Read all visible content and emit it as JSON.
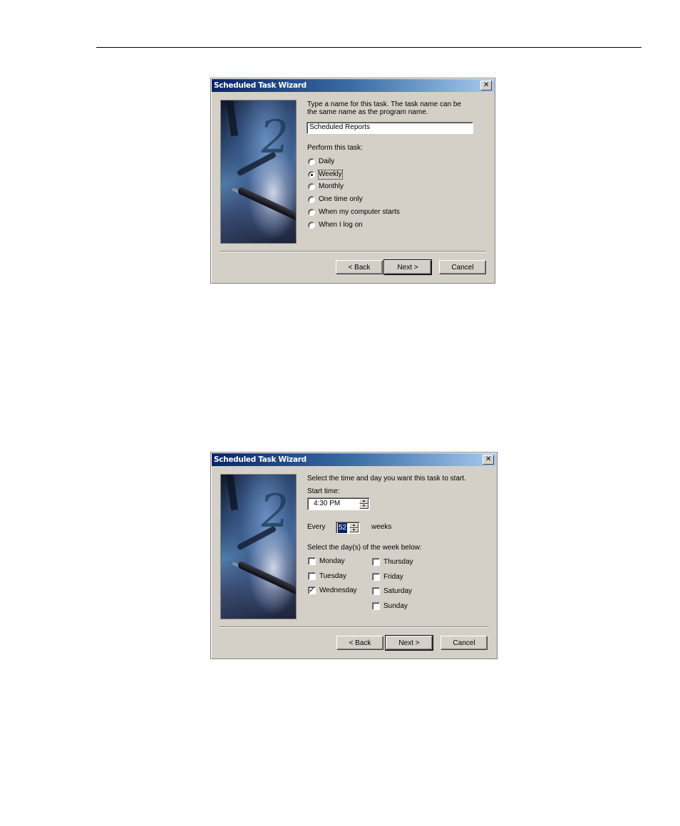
{
  "dialog1": {
    "title": "Scheduled Task Wizard",
    "close_label": "✕",
    "prompt": "Type a name for this task.  The task name can be",
    "prompt2": "the same name as the program name.",
    "task_name_value": "Scheduled Reports",
    "perform_label": "Perform this task:",
    "options": [
      {
        "label": "Daily",
        "checked": false
      },
      {
        "label": "Weekly",
        "checked": true
      },
      {
        "label": "Monthly",
        "checked": false
      },
      {
        "label": "One time only",
        "checked": false
      },
      {
        "label": "When my computer starts",
        "checked": false
      },
      {
        "label": "When I log on",
        "checked": false
      }
    ],
    "buttons": {
      "back": "< Back",
      "next": "Next >",
      "cancel": "Cancel"
    }
  },
  "dialog2": {
    "title": "Scheduled Task Wizard",
    "close_label": "✕",
    "prompt": "Select the time and day you want this task to start.",
    "start_time_label": "Start time:",
    "start_time_value": "4:30 PM",
    "every_label": "Every",
    "every_value": "52",
    "weeks_label": "weeks",
    "days_label": "Select the day(s) of the week below:",
    "days": [
      {
        "label": "Monday",
        "checked": false
      },
      {
        "label": "Tuesday",
        "checked": false
      },
      {
        "label": "Wednesday",
        "checked": true
      },
      {
        "label": "Thursday",
        "checked": false
      },
      {
        "label": "Friday",
        "checked": false
      },
      {
        "label": "Saturday",
        "checked": false
      },
      {
        "label": "Sunday",
        "checked": false
      }
    ],
    "buttons": {
      "back": "< Back",
      "next": "Next >",
      "cancel": "Cancel"
    }
  },
  "icons": {
    "check": "✓",
    "spin_up": "▲",
    "spin_down": "▼"
  }
}
